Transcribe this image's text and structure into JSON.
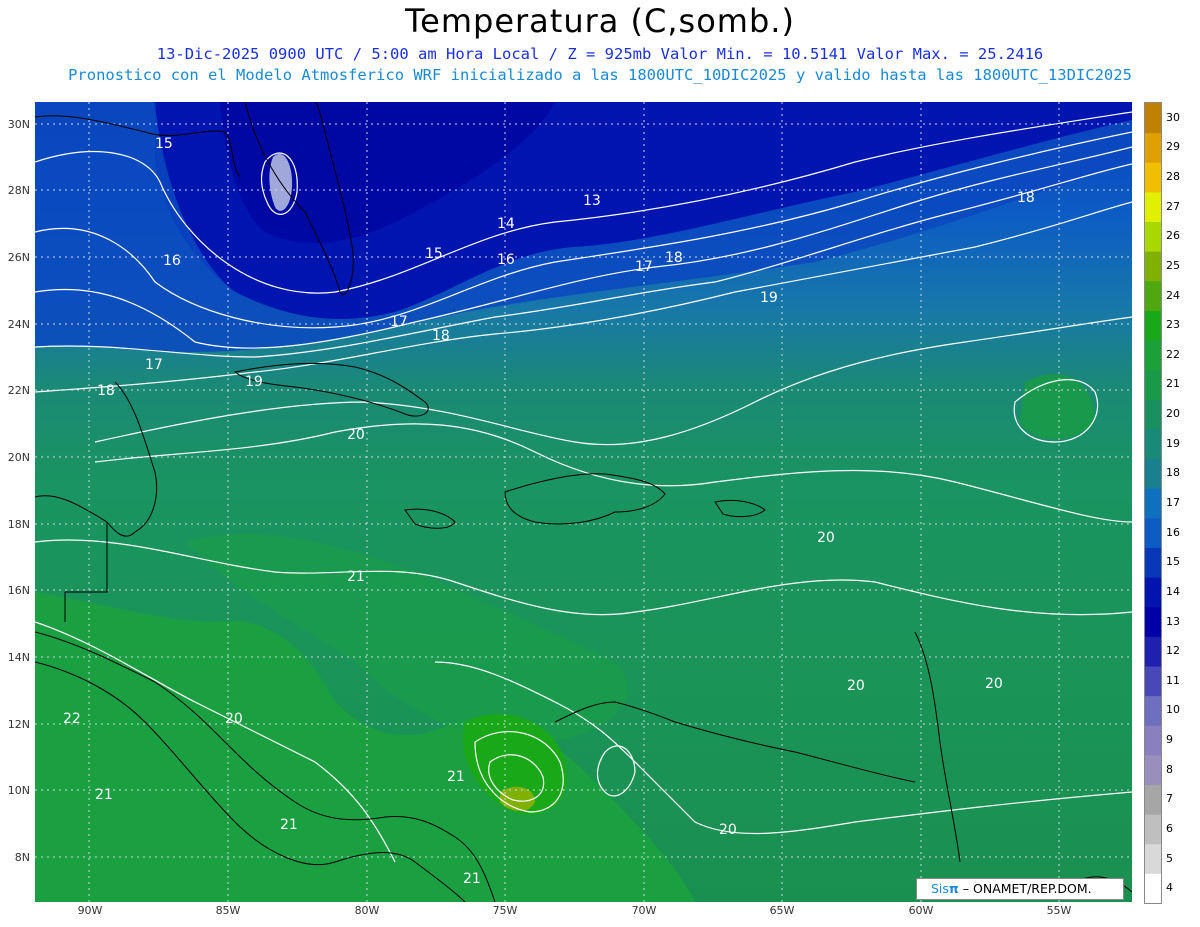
{
  "header": {
    "title": "Temperatura (C,somb.)",
    "subtitle1": "13-Dic-2025  0900 UTC / 5:00 am Hora Local / Z = 925mb    Valor Min. = 10.5141  Valor Max. = 25.2416",
    "subtitle2": "Pronostico con el Modelo Atmosferico WRF inicializado a las 1800UTC_10DIC2025 y valido hasta las  1800UTC_13DIC2025"
  },
  "axes": {
    "x_ticks": [
      "90W",
      "85W",
      "80W",
      "75W",
      "70W",
      "65W",
      "60W",
      "55W"
    ],
    "y_ticks": [
      "30N",
      "28N",
      "26N",
      "24N",
      "22N",
      "20N",
      "18N",
      "16N",
      "14N",
      "12N",
      "10N",
      "8N"
    ]
  },
  "colorbar": {
    "labels": [
      "4",
      "5",
      "6",
      "7",
      "8",
      "9",
      "10",
      "11",
      "12",
      "13",
      "14",
      "15",
      "16",
      "17",
      "18",
      "19",
      "20",
      "21",
      "22",
      "23",
      "24",
      "25",
      "26",
      "27",
      "28",
      "29",
      "30"
    ],
    "colors": [
      "#ffffff",
      "#d9d9d9",
      "#bfbfbf",
      "#a6a6a6",
      "#9a8fbc",
      "#8a7fbf",
      "#6f6fbf",
      "#4848b8",
      "#2020b0",
      "#0000a8",
      "#0014b0",
      "#0838b8",
      "#0c5cc4",
      "#1070c0",
      "#1a8090",
      "#1a8a78",
      "#1a9060",
      "#1a9a48",
      "#1aa238",
      "#18a818",
      "#50a810",
      "#80b000",
      "#a8d800",
      "#e0f000",
      "#f0c000",
      "#e0a000",
      "#c08000"
    ]
  },
  "contour_labels": [
    {
      "text": "15"
    },
    {
      "text": "16"
    },
    {
      "text": "15"
    },
    {
      "text": "14"
    },
    {
      "text": "13"
    },
    {
      "text": "16"
    },
    {
      "text": "17"
    },
    {
      "text": "18"
    },
    {
      "text": "18"
    },
    {
      "text": "19"
    },
    {
      "text": "17"
    },
    {
      "text": "18"
    },
    {
      "text": "17"
    },
    {
      "text": "18"
    },
    {
      "text": "19"
    },
    {
      "text": "20"
    },
    {
      "text": "21"
    },
    {
      "text": "20"
    },
    {
      "text": "20"
    },
    {
      "text": "20"
    },
    {
      "text": "22"
    },
    {
      "text": "20"
    },
    {
      "text": "21"
    },
    {
      "text": "21"
    },
    {
      "text": "21"
    },
    {
      "text": "20"
    },
    {
      "text": "21"
    }
  ],
  "credit": {
    "brand": "Sis",
    "pi": "π",
    "org": " – ONAMET/REP.DOM."
  }
}
